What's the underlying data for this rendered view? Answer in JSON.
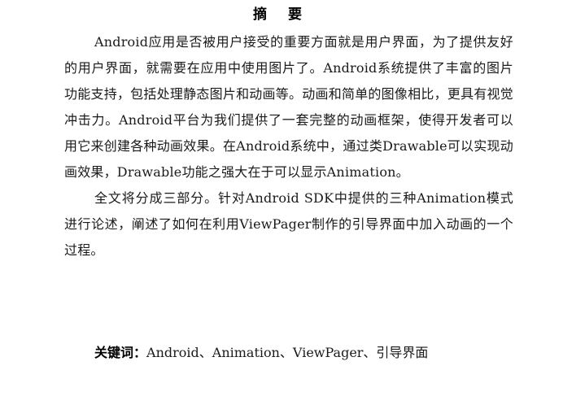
{
  "document": {
    "title": "摘  要",
    "paragraphs": [
      "Android应用是否被用户接受的重要方面就是用户界面，为了提供友好的用户界面，就需要在应用中使用图片了。Android系统提供了丰富的图片功能支持，包括处理静态图片和动画等。动画和简单的图像相比，更具有视觉冲击力。Android平台为我们提供了一套完整的动画框架，使得开发者可以用它来创建各种动画效果。在Android系统中，通过类Drawable可以实现动画效果，Drawable功能之强大在于可以显示Animation。",
      "全文将分成三部分。针对Android SDK中提供的三种Animation模式进行论述，阐述了如何在利用ViewPager制作的引导界面中加入动画的一个过程。"
    ],
    "keywords_label": "关键词：",
    "keywords": "Android、Animation、ViewPager、引导界面"
  }
}
